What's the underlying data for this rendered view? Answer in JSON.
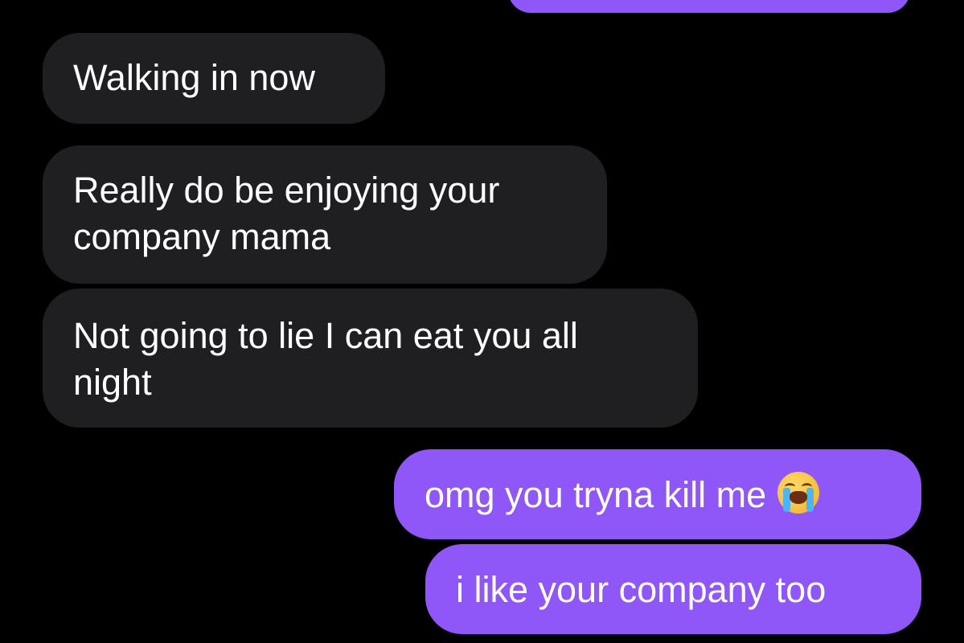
{
  "conversation": {
    "top_bubble_text": "",
    "messages": [
      {
        "direction": "incoming",
        "lines": [
          "Walking in now"
        ]
      },
      {
        "direction": "incoming",
        "lines": [
          "Really do be enjoying your",
          "company mama"
        ]
      },
      {
        "direction": "incoming",
        "lines": [
          "Not going to lie I can eat you all",
          "night"
        ]
      },
      {
        "direction": "outgoing",
        "lines": [
          "omg you tryna kill me"
        ],
        "emoji": "loudly-crying-face-icon"
      },
      {
        "direction": "outgoing",
        "lines": [
          "i like your company too"
        ]
      }
    ]
  },
  "colors": {
    "background": "#000000",
    "incoming_bubble": "#1f1f21",
    "outgoing_bubble": "#8f57f8",
    "text": "#ffffff"
  }
}
